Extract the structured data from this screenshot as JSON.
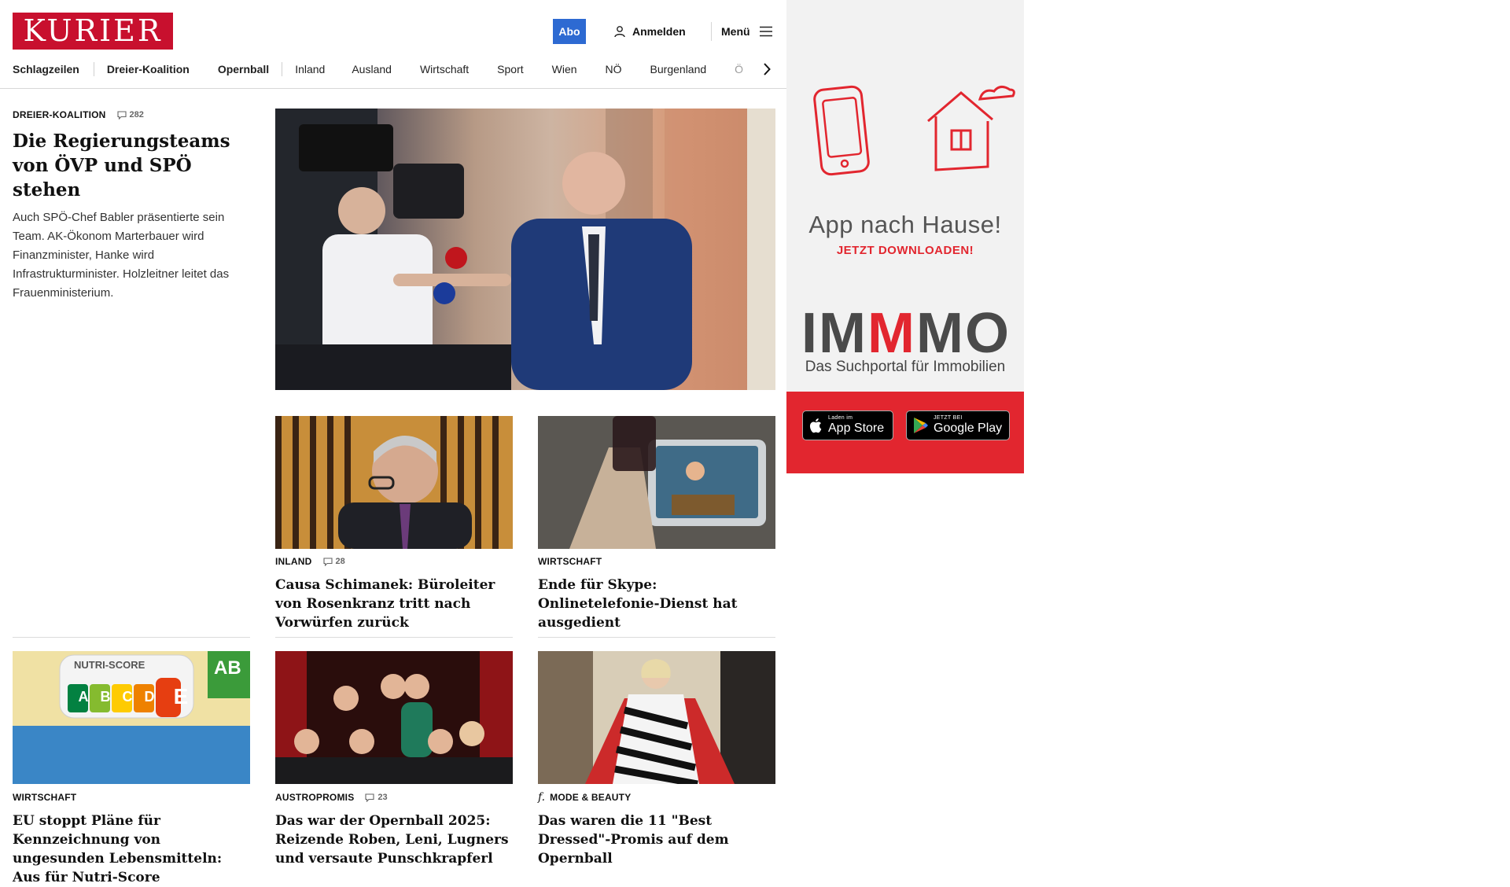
{
  "header": {
    "logo": "KURIER",
    "abo_label": "Abo",
    "login_label": "Anmelden",
    "menu_label": "Menü"
  },
  "nav": {
    "items": [
      "Schlagzeilen",
      "Dreier-Koalition",
      "Opernball",
      "Inland",
      "Ausland",
      "Wirtschaft",
      "Sport",
      "Wien",
      "NÖ",
      "Burgenland",
      "Ö"
    ]
  },
  "lead": {
    "category": "DREIER-KOALITION",
    "comments": "282",
    "title": "Die Regierungsteams von ÖVP und SPÖ stehen",
    "teaser": "Auch SPÖ-Chef Babler präsentierte sein Team. AK-Ökonom Marterbauer wird Finanzminister, Hanke wird Infrastrukturminister. Holzleitner leitet das Frauenministerium."
  },
  "cards": [
    {
      "category": "INLAND",
      "comments": "28",
      "title": "Causa Schimanek: Büroleiter von Rosenkranz tritt nach Vorwürfen zurück"
    },
    {
      "category": "WIRTSCHAFT",
      "comments": "",
      "title": "Ende für Skype: Onlinetelefonie-Dienst hat ausgedient"
    },
    {
      "category": "WIRTSCHAFT",
      "comments": "",
      "title": "EU stoppt Pläne für Kennzeichnung von ungesunden Lebensmitteln: Aus für Nutri-Score"
    },
    {
      "category": "AUSTROPROMIS",
      "comments": "23",
      "title": "Das war der Opernball 2025: Reizende Roben, Leni, Lugners und versaute Punschkrapferl"
    },
    {
      "category": "MODE & BEAUTY",
      "comments": "",
      "title": "Das waren die 11 \"Best Dressed\"-Promis auf dem Opernball"
    }
  ],
  "nutri": {
    "label": "NUTRI-SCORE",
    "letters": [
      "A",
      "B",
      "C",
      "D",
      "E"
    ],
    "bio": "AB"
  },
  "ad": {
    "headline": "App nach Hause!",
    "cta": "JETZT DOWNLOADEN!",
    "brand_a": "IM",
    "brand_m": "M",
    "brand_b": "MO",
    "subline": "Das Suchportal für Immobilien",
    "appstore_small": "Laden im",
    "appstore_big": "App Store",
    "googleplay_small": "JETZT BEI",
    "googleplay_big": "Google Play"
  },
  "colors": {
    "brand_red": "#c8102e",
    "abo_blue": "#2d6ad2",
    "ad_red": "#e2262f"
  }
}
